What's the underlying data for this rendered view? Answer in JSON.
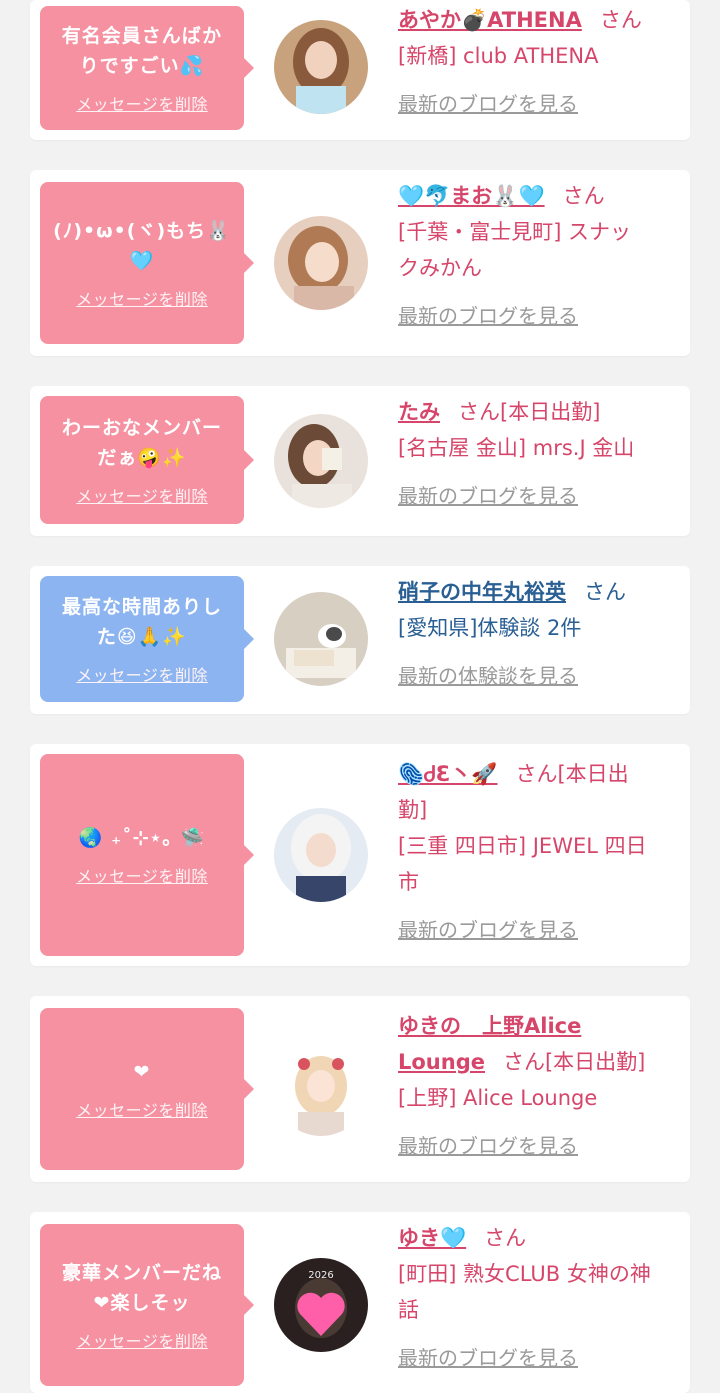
{
  "cards": [
    {
      "message_lines": [
        "有名会員さんばか",
        "りですごい💦"
      ],
      "delete_label": "メッセージを削除",
      "bubble_color": "#f591a1",
      "name": "あやか💣ATHENA",
      "suffix": "さん",
      "location_lines": [
        "[新橋] club ATHENA"
      ],
      "blog_label": "最新のブログを見る",
      "text_color": "#d6466a"
    },
    {
      "message_lines": [
        "(ﾉ)•ω•(ヾ)もち🐰",
        "🩵"
      ],
      "delete_label": "メッセージを削除",
      "bubble_color": "#f591a1",
      "name": "🩵🐬まお🐰🩵",
      "suffix": "さん",
      "location_lines": [
        "[千葉・富士見町] スナッ",
        "クみかん"
      ],
      "blog_label": "最新のブログを見る",
      "text_color": "#d6466a"
    },
    {
      "message_lines": [
        "わーおなメンバー",
        "だぁ🤪✨"
      ],
      "delete_label": "メッセージを削除",
      "bubble_color": "#f591a1",
      "name": "たみ",
      "suffix": "さん[本日出勤]",
      "location_lines": [
        "[名古屋 金山] mrs.J 金山"
      ],
      "blog_label": "最新のブログを見る",
      "text_color": "#d6466a"
    },
    {
      "message_lines": [
        "最高な時間ありし",
        "た😆🙏✨"
      ],
      "delete_label": "メッセージを削除",
      "bubble_color": "#8cb4f0",
      "name": "硝子の中年丸裕英",
      "suffix": "さん",
      "location_lines": [
        "[愛知県]体験談 2件"
      ],
      "blog_label": "最新の体験談を見る",
      "text_color": "#2a5f94"
    },
    {
      "message_lines": [
        "🌏 ₊˚⊹⋆｡ 🛸"
      ],
      "delete_label": "メッセージを削除",
      "bubble_color": "#f591a1",
      "name": "🫆ᏧƐ丶🚀",
      "suffix": "さん[本日出",
      "name_line2": "勤]",
      "location_lines": [
        "[三重 四日市] JEWEL 四日",
        "市"
      ],
      "blog_label": "最新のブログを見る",
      "text_color": "#d6466a"
    },
    {
      "message_lines": [
        "❤"
      ],
      "delete_label": "メッセージを削除",
      "bubble_color": "#f591a1",
      "name": "ゆきの　上野Alice",
      "name_line2": "Lounge",
      "suffix": "さん[本日出勤]",
      "location_lines": [
        "[上野] Alice Lounge"
      ],
      "blog_label": "最新のブログを見る",
      "text_color": "#d6466a"
    },
    {
      "message_lines": [
        "豪華メンバーだね",
        "❤楽しそッ"
      ],
      "delete_label": "メッセージを削除",
      "bubble_color": "#f591a1",
      "name": "ゆき🩵",
      "suffix": "さん",
      "location_lines": [
        "[町田] 熟女CLUB 女神の神",
        "話"
      ],
      "blog_label": "最新のブログを見る",
      "text_color": "#d6466a",
      "avatar_overlay_text": "2026"
    }
  ]
}
